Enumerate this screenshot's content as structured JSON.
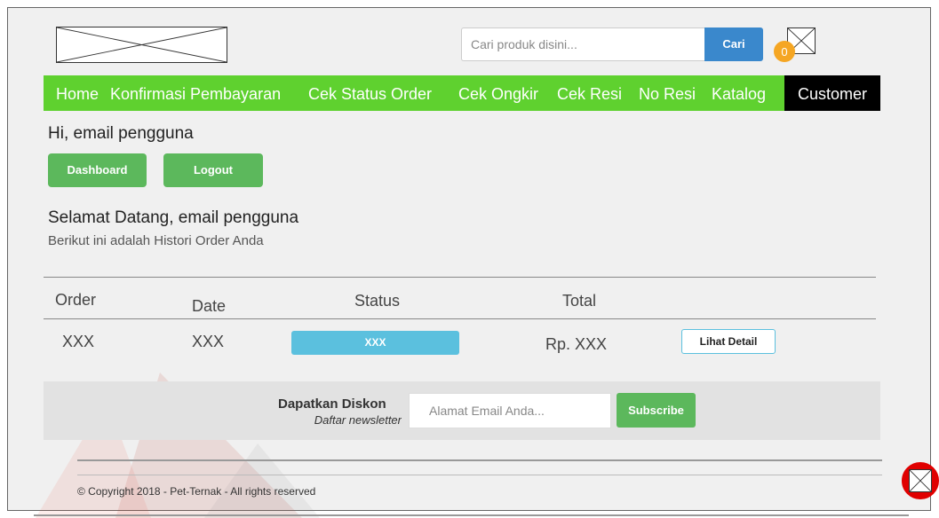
{
  "header": {
    "search": {
      "placeholder": "Cari produk disini...",
      "button_label": "Cari"
    },
    "cart_count": "0"
  },
  "nav": {
    "items": [
      "Home",
      "Konfirmasi Pembayaran",
      "Cek Status Order",
      "Cek Ongkir",
      "Cek Resi",
      "No Resi",
      "Katalog"
    ],
    "customer_label": "Customer",
    "bg_color": "#5fd12f"
  },
  "account": {
    "greeting": "Hi, email pengguna",
    "dashboard_label": "Dashboard",
    "logout_label": "Logout"
  },
  "welcome": {
    "title": "Selamat Datang, email pengguna",
    "subtitle": "Berikut ini adalah Histori Order Anda"
  },
  "orders": {
    "columns": [
      "Order",
      "Date",
      "Status",
      "Total"
    ],
    "rows": [
      {
        "order": "XXX",
        "date": "XXX",
        "status": "XXX",
        "total": "Rp. XXX",
        "action": "Lihat Detail"
      }
    ]
  },
  "newsletter": {
    "title": "Dapatkan Diskon",
    "subtitle": "Daftar newsletter",
    "email_placeholder": "Alamat Email Anda...",
    "subscribe_label": "Subscribe"
  },
  "footer": {
    "copyright": "© Copyright 2018 - Pet-Ternak - All rights reserved"
  }
}
